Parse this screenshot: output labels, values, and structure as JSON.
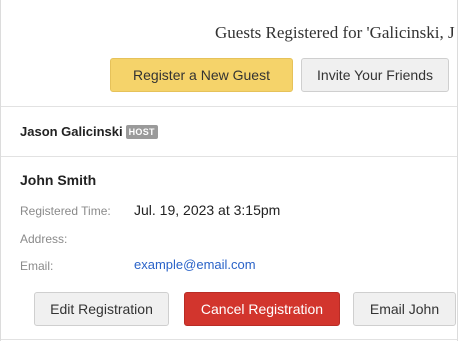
{
  "page": {
    "title": "Guests Registered for 'Galicinski, J"
  },
  "actions": {
    "register_label": "Register a New Guest",
    "invite_label": "Invite Your Friends"
  },
  "host": {
    "name": "Jason Galicinski",
    "badge": "HOST"
  },
  "guest": {
    "name": "John Smith",
    "registered_time_label": "Registered Time:",
    "registered_time": "Jul. 19, 2023 at 3:15pm",
    "address_label": "Address:",
    "address": "",
    "email_label": "Email:",
    "email": "example@email.com",
    "edit_label": "Edit Registration",
    "cancel_label": "Cancel Registration",
    "email_button_label": "Email John"
  },
  "colors": {
    "register_button": "#f5d36a",
    "cancel_button": "#d2352d",
    "link": "#2a63c8"
  }
}
